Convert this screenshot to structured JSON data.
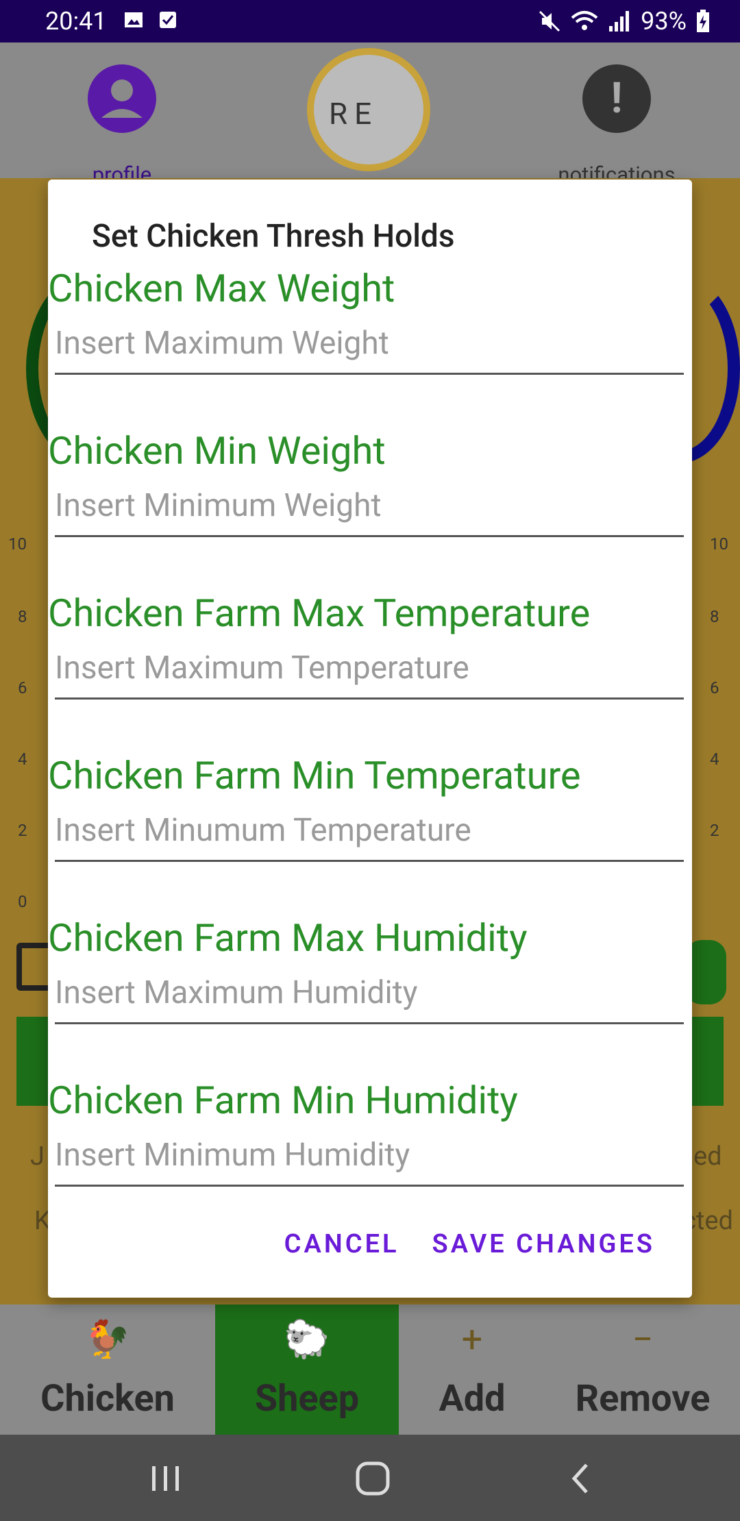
{
  "status_bar": {
    "time": "20:41",
    "battery": "93%"
  },
  "app_bar": {
    "profile_label": "profile",
    "notifications_label": "notifications",
    "logo_text": "RE"
  },
  "background": {
    "axis_ticks": [
      "10",
      "8",
      "6",
      "4",
      "2",
      "0"
    ],
    "right_axis_ticks": [
      "10",
      "8",
      "6",
      "4",
      "2"
    ],
    "fragment_left_1": "J",
    "fragment_left_2": "K",
    "fragment_right_1": "ed",
    "fragment_right_2": "cted"
  },
  "dialog": {
    "title": "Set Chicken Thresh Holds",
    "fields": [
      {
        "label": "Chicken Max Weight",
        "placeholder": "Insert Maximum Weight",
        "value": ""
      },
      {
        "label": "Chicken Min Weight",
        "placeholder": "Insert Minimum Weight",
        "value": ""
      },
      {
        "label": "Chicken Farm Max Temperature",
        "placeholder": "Insert Maximum Temperature",
        "value": ""
      },
      {
        "label": "Chicken Farm Min Temperature",
        "placeholder": "Insert Minumum Temperature",
        "value": ""
      },
      {
        "label": "Chicken Farm Max Humidity",
        "placeholder": "Insert Maximum Humidity",
        "value": ""
      },
      {
        "label": "Chicken Farm Min Humidity",
        "placeholder": "Insert Minimum Humidity",
        "value": ""
      }
    ],
    "cancel_label": "CANCEL",
    "save_label": "SAVE CHANGES"
  },
  "bottom_nav": {
    "items": [
      {
        "label": "Chicken",
        "icon": "chicken-icon"
      },
      {
        "label": "Sheep",
        "icon": "sheep-icon"
      },
      {
        "label": "Add",
        "icon": "plus-icon"
      },
      {
        "label": "Remove",
        "icon": "minus-icon"
      }
    ]
  },
  "colors": {
    "status_bar": "#1a0058",
    "label_green": "#2a8f28",
    "accent_purple": "#6a1bd8",
    "sheep_selected": "#1c6e18"
  }
}
